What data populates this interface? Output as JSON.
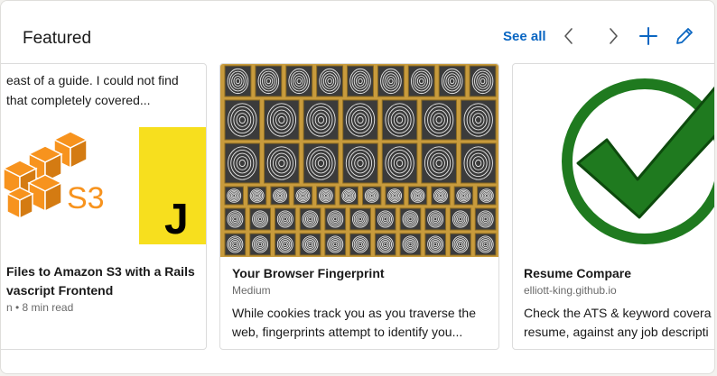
{
  "header": {
    "title": "Featured",
    "see_all_label": "See all"
  },
  "toolbar": {
    "icons": [
      "chevron-left-icon",
      "chevron-right-icon",
      "plus-icon",
      "pencil-icon"
    ]
  },
  "colors": {
    "accent": "#0a66c2",
    "aws_orange": "#f7931e",
    "js_yellow": "#f7df1e",
    "check_green": "#1f7a1f",
    "fingerprint_frame": "#c89b3c"
  },
  "cards": [
    {
      "snippet_line1": "east of a guide. I could not find",
      "snippet_line2": "that completely covered...",
      "logo_text": "S3",
      "js_letter": "J",
      "title_line1": "Files to Amazon S3 with a Rails",
      "title_line2": "vascript Frontend",
      "meta": "n • 8 min read"
    },
    {
      "title": "Your Browser Fingerprint",
      "source": "Medium",
      "desc_line1": "While cookies track you as you traverse the",
      "desc_line2": "web, fingerprints attempt to identify you..."
    },
    {
      "title": "Resume Compare",
      "source": "elliott-king.github.io",
      "desc_line1": "Check the ATS & keyword covera",
      "desc_line2": "resume, against any job descripti"
    }
  ]
}
